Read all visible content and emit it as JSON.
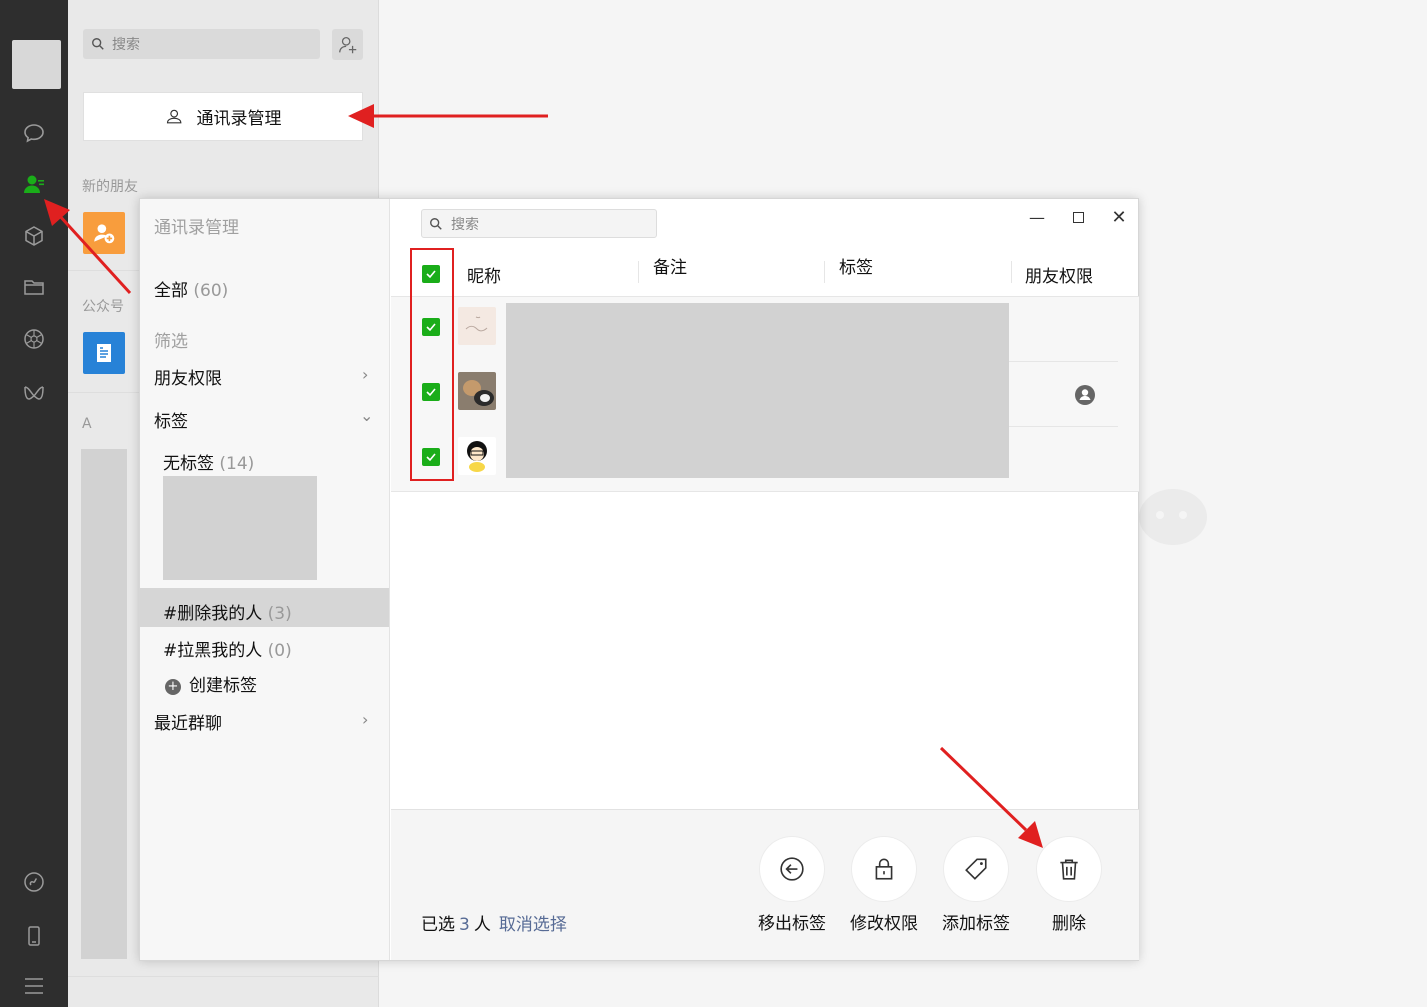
{
  "sidebar": {
    "search_placeholder": "搜索",
    "manage_button_label": "通讯录管理",
    "new_friends_label": "新的朋友",
    "official_accounts_label": "公众号",
    "index_letter": "A"
  },
  "modal": {
    "title": "通讯录管理",
    "filter_menu": {
      "all_label": "全部",
      "all_count": "(60)",
      "filter_heading": "筛选",
      "friend_permission_label": "朋友权限",
      "tags_label": "标签",
      "no_tag_label": "无标签",
      "no_tag_count": "(14)",
      "tag_deleted_me_label": "#删除我的人",
      "tag_deleted_me_count": "(3)",
      "tag_blocked_me_label": "#拉黑我的人",
      "tag_blocked_me_count": "(0)",
      "create_tag_label": "创建标签",
      "recent_groups_label": "最近群聊"
    },
    "search_placeholder": "搜索",
    "table": {
      "columns": [
        "昵称",
        "备注",
        "标签",
        "朋友权限"
      ],
      "rows_selected": [
        true,
        true,
        true
      ]
    },
    "footer": {
      "selected_prefix": "已选",
      "selected_count": "3",
      "selected_suffix": "人",
      "cancel_selection": "取消选择",
      "actions": [
        "移出标签",
        "修改权限",
        "添加标签",
        "删除"
      ]
    }
  },
  "colors": {
    "accent_green": "#1aad19",
    "link_blue": "#576b95",
    "annotation_red": "#e02020"
  }
}
